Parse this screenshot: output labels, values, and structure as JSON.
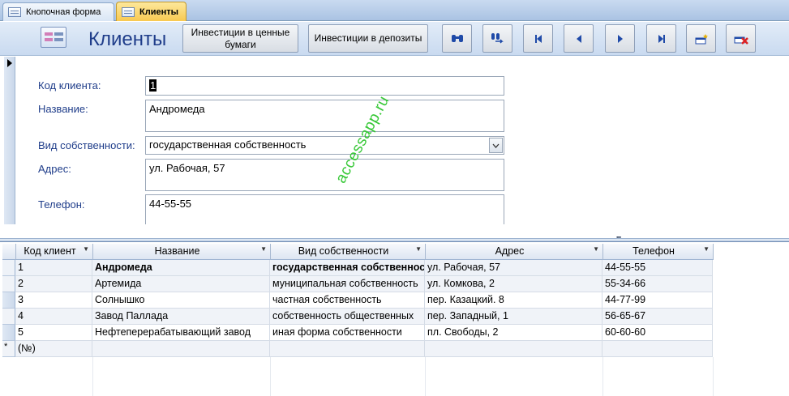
{
  "tabs": [
    {
      "label": "Кнопочная форма"
    },
    {
      "label": "Клиенты"
    }
  ],
  "header": {
    "title": "Клиенты",
    "buttons": {
      "securities": "Инвестиции в ценные бумаги",
      "deposits": "Инвестиции в депозиты"
    },
    "icon_buttons": [
      "find-icon",
      "replace-icon",
      "first-record-icon",
      "previous-record-icon",
      "next-record-icon",
      "last-record-icon",
      "new-record-icon",
      "delete-record-icon"
    ]
  },
  "form": {
    "code_label": "Код клиента:",
    "code_value": "1",
    "name_label": "Название:",
    "name_value": "Андромеда",
    "owner_label": "Вид собственности:",
    "owner_value": "государственная собственность",
    "address_label": "Адрес:",
    "address_value": "ул. Рабочая, 57",
    "phone_label": "Телефон:",
    "phone_value": "44-55-55"
  },
  "watermark": "accessapp.ru",
  "datasheet": {
    "columns": [
      "Код клиент",
      "Название",
      "Вид собственности",
      "Адрес",
      "Телефон"
    ],
    "rows": [
      [
        "1",
        "Андромеда",
        "государственная собственность",
        "ул. Рабочая, 57",
        "44-55-55"
      ],
      [
        "2",
        "Артемида",
        "муниципальная собственность",
        "ул. Комкова, 2",
        "55-34-66"
      ],
      [
        "3",
        "Солнышко",
        "частная собственность",
        "пер. Казацкий. 8",
        "44-77-99"
      ],
      [
        "4",
        "Завод Паллада",
        "собственность общественных",
        "пер. Западный, 1",
        "56-65-67"
      ],
      [
        "5",
        "Нефтеперерабатывающий завод",
        "иная форма собственности",
        "пл. Свободы, 2",
        "60-60-60"
      ]
    ],
    "new_row_marker": "*",
    "new_row_code": "(№)"
  },
  "colors": {
    "title": "#1f3d8a",
    "active_tab": "#f8c951",
    "watermark": "#37c837"
  }
}
